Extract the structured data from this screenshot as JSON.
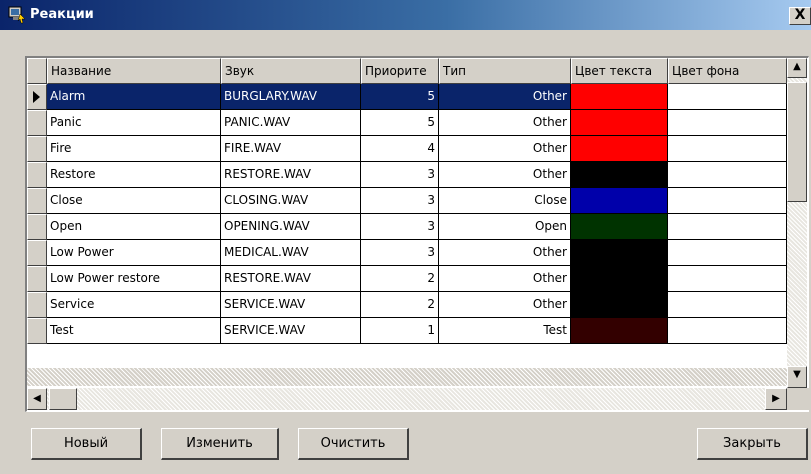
{
  "window": {
    "title": "Реакции",
    "close_label": "X"
  },
  "columns": [
    "Название",
    "Звук",
    "Приорите",
    "Тип",
    "Цвет текста",
    "Цвет фона"
  ],
  "rows": [
    {
      "name": "Alarm",
      "sound": "BURGLARY.WAV",
      "priority": "5",
      "type": "Other",
      "text_color": "#ff0000",
      "selected": true
    },
    {
      "name": "Panic",
      "sound": "PANIC.WAV",
      "priority": "5",
      "type": "Other",
      "text_color": "#ff0000"
    },
    {
      "name": "Fire",
      "sound": "FIRE.WAV",
      "priority": "4",
      "type": "Other",
      "text_color": "#ff0000"
    },
    {
      "name": "Restore",
      "sound": "RESTORE.WAV",
      "priority": "3",
      "type": "Other",
      "text_color": "#000000"
    },
    {
      "name": "Close",
      "sound": "CLOSING.WAV",
      "priority": "3",
      "type": "Close",
      "text_color": "#0000aa"
    },
    {
      "name": "Open",
      "sound": "OPENING.WAV",
      "priority": "3",
      "type": "Open",
      "text_color": "#003300"
    },
    {
      "name": "Low Power",
      "sound": "MEDICAL.WAV",
      "priority": "3",
      "type": "Other",
      "text_color": "#000000"
    },
    {
      "name": "Low Power restore",
      "sound": "RESTORE.WAV",
      "priority": "2",
      "type": "Other",
      "text_color": "#000000"
    },
    {
      "name": "Service",
      "sound": "SERVICE.WAV",
      "priority": "2",
      "type": "Other",
      "text_color": "#000000"
    },
    {
      "name": "Test",
      "sound": "SERVICE.WAV",
      "priority": "1",
      "type": "Test",
      "text_color": "#330000"
    }
  ],
  "buttons": {
    "new": "Новый",
    "edit": "Изменить",
    "clear": "Очистить",
    "close": "Закрыть"
  }
}
